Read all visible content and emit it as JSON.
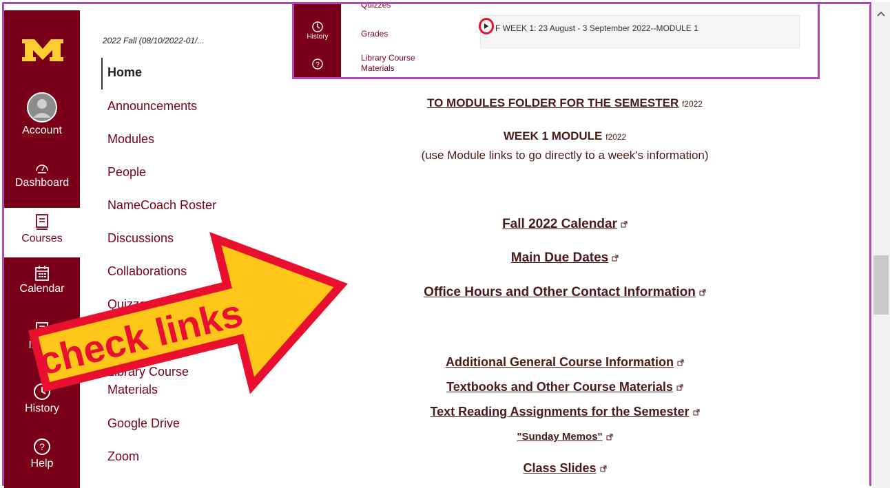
{
  "global_nav": {
    "items": [
      {
        "label": "Account",
        "icon": "avatar-icon"
      },
      {
        "label": "Dashboard",
        "icon": "dashboard-icon"
      },
      {
        "label": "Courses",
        "icon": "courses-icon"
      },
      {
        "label": "Calendar",
        "icon": "calendar-icon"
      },
      {
        "label": "Inbox",
        "icon": "inbox-icon"
      },
      {
        "label": "History",
        "icon": "history-icon"
      },
      {
        "label": "Help",
        "icon": "help-icon"
      }
    ]
  },
  "course": {
    "title": "2022 Fall (08/10/2022-01/...",
    "nav": [
      "Home",
      "Announcements",
      "Modules",
      "People",
      "NameCoach Roster",
      "Discussions",
      "Collaborations",
      "Quizzes",
      "Library Course",
      "Materials",
      "Google Drive",
      "Zoom"
    ]
  },
  "embedded": {
    "nav_history": "History",
    "links": [
      "Quizzes",
      "Grades",
      "Library Course",
      "Materials"
    ],
    "week_label": "F WEEK 1: 23 August - 3 September 2022--MODULE 1"
  },
  "content": {
    "modules_folder": "TO MODULES FOLDER FOR THE SEMESTER",
    "modules_folder_tag": "f2022",
    "week1": "WEEK 1 MODULE",
    "week1_tag": "f2022",
    "week1_note": "(use Module links to go directly to a week's information)",
    "calendar": "Fall 2022 Calendar",
    "due_dates": "Main Due Dates",
    "office_hours": "Office Hours and Other Contact Information",
    "general_info": "Additional General Course Information",
    "textbooks": "Textbooks and Other Course Materials",
    "reading": "Text Reading Assignments for the Semester",
    "memos": "\"Sunday Memos\"",
    "slides": "Class Slides"
  },
  "annotation": {
    "callout": "check links"
  },
  "colors": {
    "maroon": "#7a0019",
    "gold": "#ffcc33",
    "frame": "#b04ab6",
    "callout_red": "#e8102e"
  }
}
